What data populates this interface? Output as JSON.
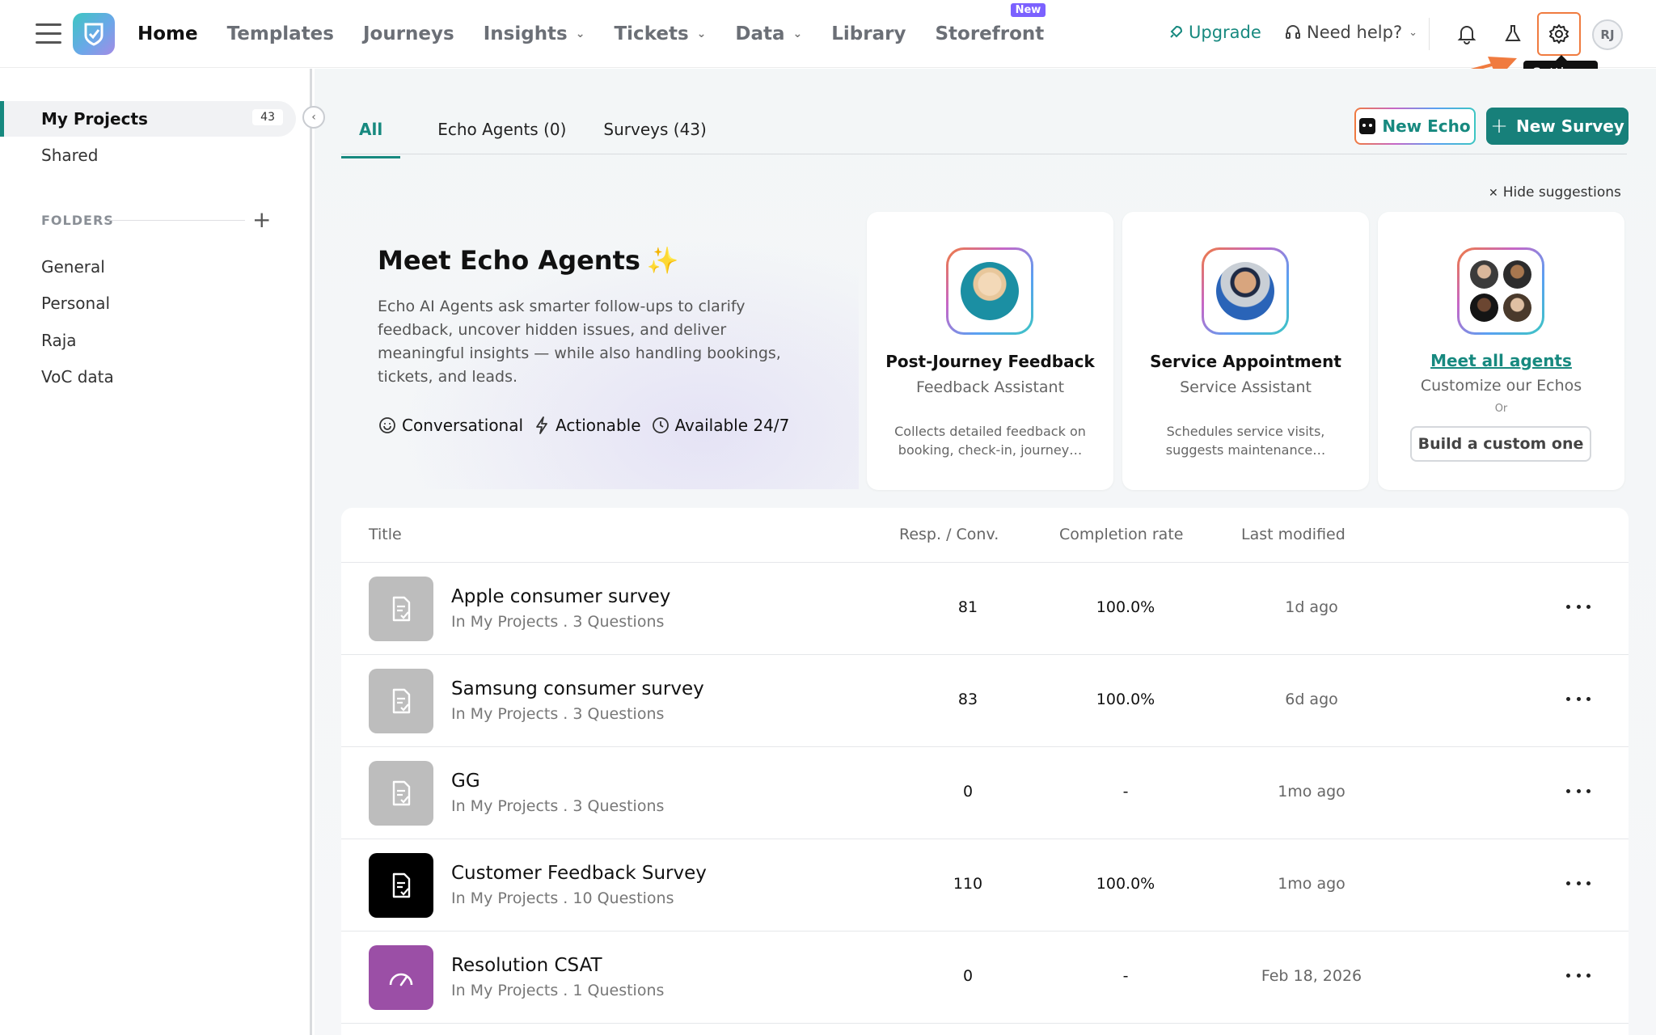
{
  "nav": {
    "items": [
      {
        "label": "Home"
      },
      {
        "label": "Templates"
      },
      {
        "label": "Journeys"
      },
      {
        "label": "Insights"
      },
      {
        "label": "Tickets"
      },
      {
        "label": "Data"
      },
      {
        "label": "Library"
      },
      {
        "label": "Storefront"
      }
    ],
    "new_badge": "New",
    "upgrade": "Upgrade",
    "help": "Need help?",
    "avatar_initials": "RJ",
    "tooltip": "Settings"
  },
  "sidebar": {
    "my_projects": "My Projects",
    "my_projects_count": "43",
    "shared": "Shared",
    "folders_label": "FOLDERS",
    "folders": [
      "General",
      "Personal",
      "Raja",
      "VoC data"
    ]
  },
  "tabs": {
    "all": "All",
    "echo": "Echo Agents (0)",
    "surveys": "Surveys (43)"
  },
  "actions": {
    "new_echo": "New Echo",
    "new_survey": "New Survey",
    "hide_suggestions": "Hide suggestions"
  },
  "hero": {
    "title": "Meet Echo Agents",
    "description": "Echo AI Agents ask smarter follow-ups to clarify feedback, uncover hidden issues, and deliver meaningful insights — while also handling bookings, tickets, and leads.",
    "features": [
      "Conversational",
      "Actionable",
      "Available 24/7"
    ]
  },
  "agents": [
    {
      "name": "Post-Journey Feedback",
      "role": "Feedback Assistant",
      "desc": "Collects detailed feedback on booking, check-in, journey…"
    },
    {
      "name": "Service Appointment",
      "role": "Service Assistant",
      "desc": "Schedules service visits, suggests maintenance…"
    }
  ],
  "meet_card": {
    "link": "Meet all agents",
    "subtitle": "Customize our Echos",
    "or": "Or",
    "build": "Build a custom one"
  },
  "table": {
    "headers": {
      "title": "Title",
      "resp": "Resp. / Conv.",
      "completion": "Completion rate",
      "modified": "Last modified"
    },
    "rows": [
      {
        "title": "Apple consumer survey",
        "sub": "In My Projects . 3 Questions",
        "resp": "81",
        "completion": "100.0%",
        "modified": "1d ago",
        "icon_color": "#bdbdbd"
      },
      {
        "title": "Samsung consumer survey",
        "sub": "In My Projects . 3 Questions",
        "resp": "83",
        "completion": "100.0%",
        "modified": "6d ago",
        "icon_color": "#bdbdbd"
      },
      {
        "title": "GG",
        "sub": "In My Projects . 3 Questions",
        "resp": "0",
        "completion": "-",
        "modified": "1mo ago",
        "icon_color": "#bdbdbd"
      },
      {
        "title": "Customer Feedback Survey",
        "sub": "In My Projects . 10 Questions",
        "resp": "110",
        "completion": "100.0%",
        "modified": "1mo ago",
        "icon_color": "#000000"
      },
      {
        "title": "Resolution CSAT",
        "sub": "In My Projects . 1 Questions",
        "resp": "0",
        "completion": "-",
        "modified": "Feb 18, 2026",
        "icon_color": "#9b4fa6"
      }
    ]
  },
  "colors": {
    "accent": "#17897f",
    "settings_highlight": "#f07b3f"
  }
}
